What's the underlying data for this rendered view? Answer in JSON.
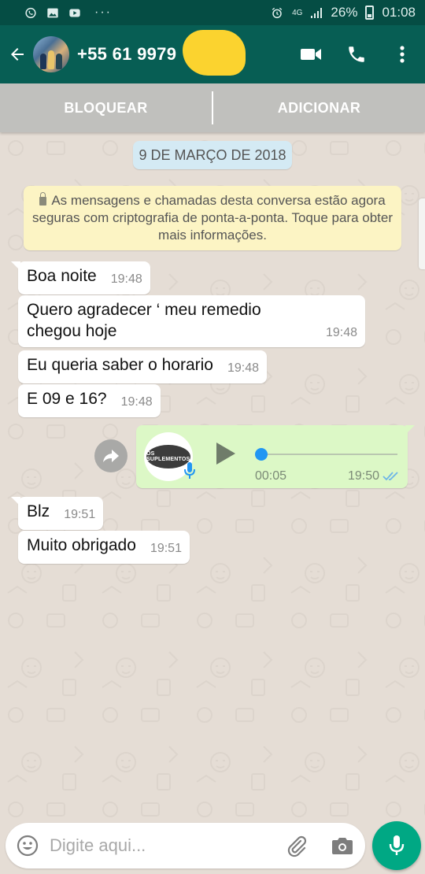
{
  "status_bar": {
    "notification_icons": [
      "whatsapp-icon",
      "gallery-icon",
      "youtube-icon"
    ],
    "more": "···",
    "network": "4G",
    "battery": "26%",
    "time": "01:08"
  },
  "header": {
    "contact": "+55 61 9979",
    "actions": [
      "video-call-icon",
      "phone-icon",
      "more-vert-icon"
    ]
  },
  "actions": {
    "block": "BLOQUEAR",
    "add": "ADICIONAR"
  },
  "chat": {
    "date": "9 DE MARÇO DE 2018",
    "encryption_notice": "As mensagens e chamadas desta conversa estão agora seguras com criptografia de ponta-a-ponta. Toque para obter mais informações.",
    "messages": [
      {
        "text": "Boa noite",
        "time": "19:48",
        "direction": "in"
      },
      {
        "text": "Quero agradecer ‘ meu remedio chegou hoje",
        "time": "19:48",
        "direction": "in"
      },
      {
        "text": "Eu queria saber o horario",
        "time": "19:48",
        "direction": "in"
      },
      {
        "text": "E 09 e 16?",
        "time": "19:48",
        "direction": "in"
      },
      {
        "text": "Blz",
        "time": "19:51",
        "direction": "in"
      },
      {
        "text": "Muito obrigado",
        "time": "19:51",
        "direction": "in"
      }
    ],
    "voice_note": {
      "avatar_text": "OS SUPLEMENTOS",
      "duration": "00:05",
      "time": "19:50",
      "progress": 0,
      "status": "delivered"
    }
  },
  "composer": {
    "placeholder": "Digite aqui..."
  },
  "colors": {
    "header": "#075e54",
    "status_bar": "#054d44",
    "chat_bg": "#e5ddd5",
    "outgoing_bubble": "#dcf8c6",
    "notice_bg": "#fcf4c4",
    "date_chip": "#d4eaf4",
    "fab": "#00a884",
    "seek": "#2196f3"
  }
}
